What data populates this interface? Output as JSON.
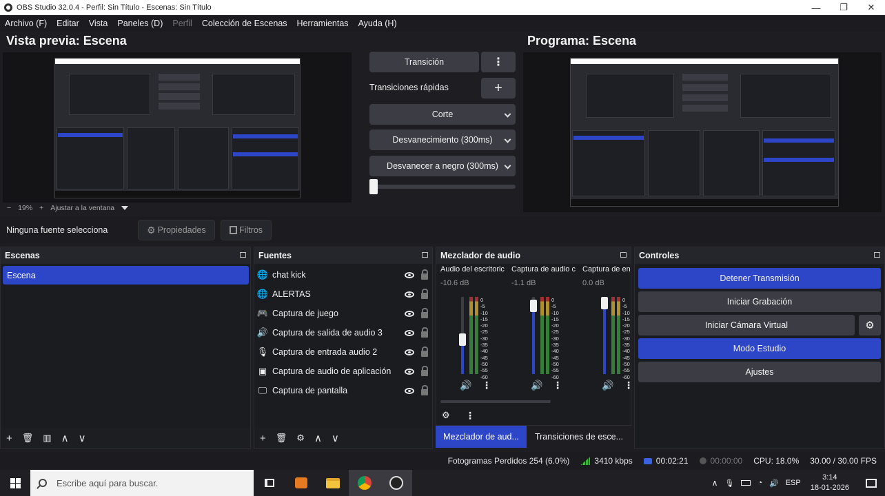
{
  "window": {
    "title": "OBS Studio 32.0.4 - Perfil: Sin Título - Escenas: Sin Título",
    "minimize": "—",
    "maximize": "❐",
    "close": "✕"
  },
  "menu": [
    "Archivo (F)",
    "Editar",
    "Vista",
    "Paneles (D)",
    "Perfil",
    "Colección de Escenas",
    "Herramientas",
    "Ayuda (H)"
  ],
  "preview": {
    "title": "Vista previa: Escena",
    "zoom_minus": "−",
    "zoom_value": "19%",
    "zoom_plus": "+",
    "fit_label": "Ajustar a la ventana"
  },
  "program": {
    "title": "Programa: Escena"
  },
  "transitions": {
    "transition_button": "Transición",
    "more_icon": "⋮",
    "quick_label": "Transiciones rápidas",
    "add_icon": "+",
    "items": [
      "Corte",
      "Desvanecimiento (300ms)",
      "Desvanecer a negro (300ms)"
    ],
    "slider_fraction": 0
  },
  "source_bar": {
    "none_selected": "Ninguna fuente selecciona",
    "properties": "Propiedades",
    "filters": "Filtros"
  },
  "scenes": {
    "title": "Escenas",
    "items": [
      "Escena"
    ],
    "footer": [
      "+",
      "🗑",
      "▥",
      "∧",
      "∨"
    ]
  },
  "sources": {
    "title": "Fuentes",
    "items": [
      {
        "label": "chat kick",
        "icon": "globe-icon",
        "glyph": "🌐"
      },
      {
        "label": "ALERTAS",
        "icon": "globe-icon",
        "glyph": "🌐"
      },
      {
        "label": "Captura de juego",
        "icon": "gamepad-icon",
        "glyph": "🎮"
      },
      {
        "label": "Captura de salida de audio 3",
        "icon": "speaker-icon",
        "glyph": "🔊"
      },
      {
        "label": "Captura de entrada audio 2",
        "icon": "microphone-icon",
        "glyph": "🎙"
      },
      {
        "label": "Captura de audio de aplicación",
        "icon": "app-audio-icon",
        "glyph": "▣"
      },
      {
        "label": "Captura de pantalla",
        "icon": "monitor-icon",
        "glyph": "🖵"
      }
    ],
    "footer": [
      "+",
      "🗑",
      "⚙",
      "∧",
      "∨"
    ]
  },
  "mixer": {
    "title": "Mezclador de audio",
    "channels": [
      {
        "name": "Audio del escritoric",
        "db": "-10.6 dB",
        "level": 0.45
      },
      {
        "name": "Captura de audio c",
        "db": "-1.1 dB",
        "level": 0.88
      },
      {
        "name": "Captura de en",
        "db": "0.0 dB",
        "level": 0.92
      }
    ],
    "scale": [
      "0",
      "-5",
      "-10",
      "-15",
      "-20",
      "-25",
      "-30",
      "-35",
      "-40",
      "-45",
      "-50",
      "-55",
      "-60"
    ],
    "volume_icon": "🔊",
    "menu_icon": "⋮",
    "settings_icon": "⚙"
  },
  "controls": {
    "title": "Controles",
    "buttons": [
      {
        "label": "Detener Transmisión",
        "active": true
      },
      {
        "label": "Iniciar Grabación",
        "active": false
      },
      {
        "label": "Iniciar Cámara Virtual",
        "active": false
      },
      {
        "label": "Modo Estudio",
        "active": true
      },
      {
        "label": "Ajustes",
        "active": false
      }
    ],
    "gear_icon": "⚙"
  },
  "tabs": [
    "Mezclador de aud...",
    "Transiciones de esce..."
  ],
  "status": {
    "dropped": "Fotogramas Perdidos 254 (6.0%)",
    "bitrate": "3410 kbps",
    "stream_time": "00:02:21",
    "rec_time": "00:00:00",
    "cpu": "CPU: 18.0%",
    "fps": "30.00 / 30.00 FPS"
  },
  "taskbar": {
    "search_placeholder": "Escribe aquí para buscar.",
    "lang": "ESP",
    "time": "3:14",
    "date": "18-01-2026"
  }
}
